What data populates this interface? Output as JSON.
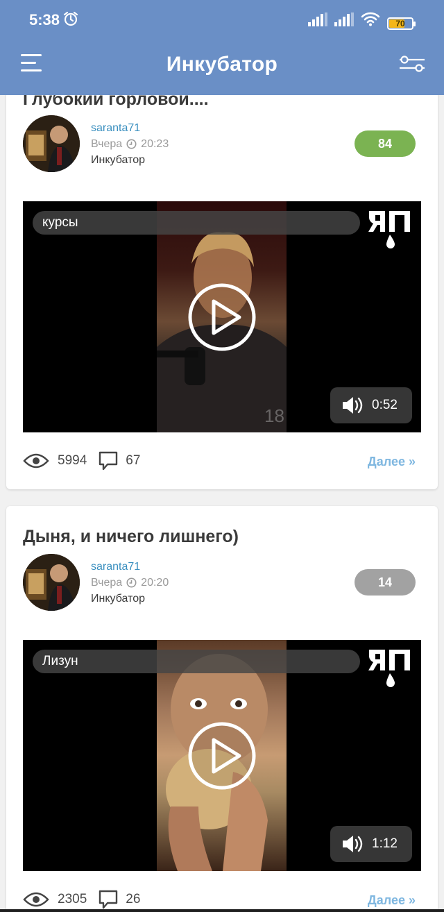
{
  "status_bar": {
    "time": "5:38",
    "battery": "70",
    "battery_level": 0.7,
    "battery_color": "#f4b61a"
  },
  "app_bar": {
    "title": "Инкубатор",
    "menu_icon": "hamburger-menu-icon",
    "filter_icon": "filter-sliders-icon",
    "color": "#6a8fc6"
  },
  "posts": [
    {
      "title": "Глубокий горловой....",
      "author": "saranta71",
      "date": "Вчера",
      "time": "20:23",
      "category": "Инкубатор",
      "rating": "84",
      "rating_color": "#7bb352",
      "video_label": "курсы",
      "video_duration": "0:52",
      "views": "5994",
      "comments": "67",
      "more": "Далее »"
    },
    {
      "title": "Дыня, и ничего лишнего)",
      "author": "saranta71",
      "date": "Вчера",
      "time": "20:20",
      "category": "Инкубатор",
      "rating": "14",
      "rating_color": "#a2a2a2",
      "video_label": "Лизун",
      "video_duration": "1:12",
      "views": "2305",
      "comments": "26",
      "more": "Далее »"
    }
  ]
}
